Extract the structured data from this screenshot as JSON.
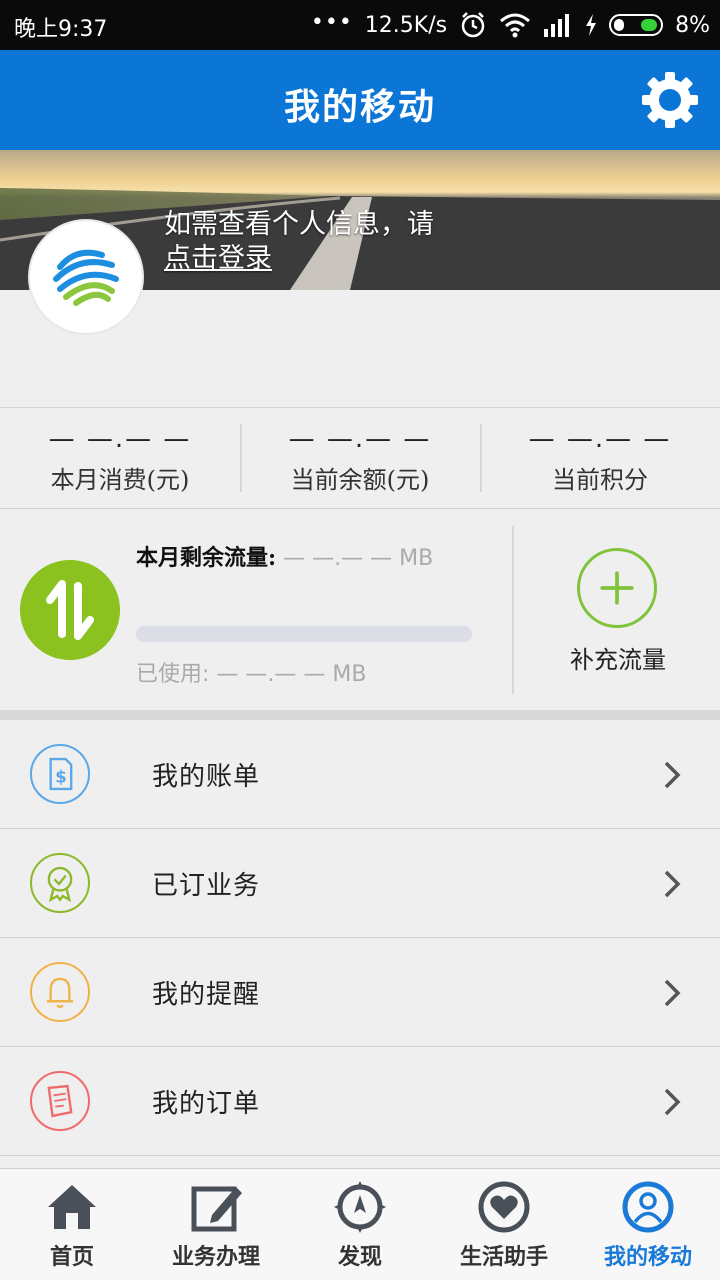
{
  "status_bar": {
    "time": "晚上9:37",
    "dots": "•••",
    "speed": "12.5K/s",
    "battery": "8%",
    "icons": [
      "alarm-icon",
      "wifi-icon",
      "signal-icon",
      "charging-icon",
      "battery-icon"
    ]
  },
  "header": {
    "title": "我的移动",
    "settings_icon": "gear-icon"
  },
  "banner": {
    "hint": "如需查看个人信息，请",
    "login_link": "点击登录"
  },
  "stats": [
    {
      "value": "— —.— —",
      "label": "本月消费(元)"
    },
    {
      "value": "— —.— —",
      "label": "当前余额(元)"
    },
    {
      "value": "— —.— —",
      "label": "当前积分"
    }
  ],
  "flow": {
    "remain_label": "本月剩余流量:",
    "remain_value": " — —.— — MB",
    "used_label": "已使用:",
    "used_value": " — —.— — MB",
    "progress": 0,
    "add_label": "补充流量"
  },
  "menu": [
    {
      "label": "我的账单",
      "icon": "bill-icon",
      "color": "#5aa8e8"
    },
    {
      "label": "已订业务",
      "icon": "badge-icon",
      "color": "#8cb82c"
    },
    {
      "label": "我的提醒",
      "icon": "bell-icon",
      "color": "#f0b24a"
    },
    {
      "label": "我的订单",
      "icon": "order-icon",
      "color": "#ef6b6b"
    }
  ],
  "bottom_nav": [
    {
      "label": "首页",
      "icon": "home-icon"
    },
    {
      "label": "业务办理",
      "icon": "edit-icon"
    },
    {
      "label": "发现",
      "icon": "compass-icon"
    },
    {
      "label": "生活助手",
      "icon": "heart-icon"
    },
    {
      "label": "我的移动",
      "icon": "user-icon",
      "active": true
    }
  ],
  "colors": {
    "accent": "#0c76d6",
    "flow_green": "#8cc220",
    "active_nav": "#1a7ad6"
  }
}
